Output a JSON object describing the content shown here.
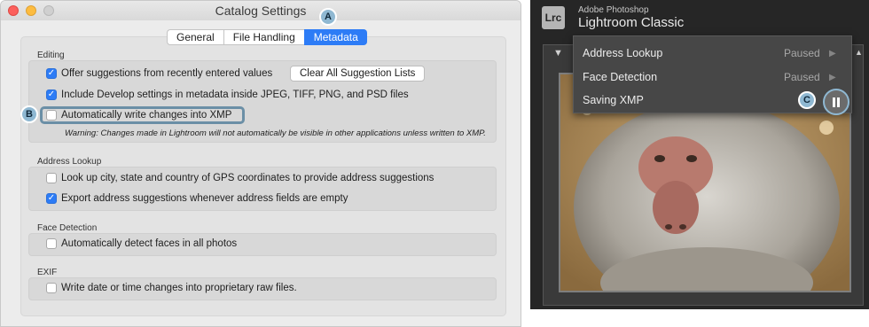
{
  "dialog": {
    "title": "Catalog Settings",
    "tabs": [
      {
        "label": "General",
        "active": false
      },
      {
        "label": "File Handling",
        "active": false
      },
      {
        "label": "Metadata",
        "active": true
      }
    ],
    "sections": {
      "editing": {
        "label": "Editing",
        "offer_suggestions": {
          "label": "Offer suggestions from recently entered values",
          "checked": true
        },
        "clear_button": "Clear All Suggestion Lists",
        "include_develop": {
          "label": "Include Develop settings in metadata inside JPEG, TIFF, PNG, and PSD files",
          "checked": true
        },
        "auto_write_xmp": {
          "label": "Automatically write changes into XMP",
          "checked": false
        },
        "warning": "Warning: Changes made in Lightroom will not automatically be visible in other applications unless written to XMP."
      },
      "address_lookup": {
        "label": "Address Lookup",
        "lookup_gps": {
          "label": "Look up city, state and country of GPS coordinates to provide address suggestions",
          "checked": false
        },
        "export_suggestions": {
          "label": "Export address suggestions whenever address fields are empty",
          "checked": true
        }
      },
      "face_detection": {
        "label": "Face Detection",
        "auto_detect": {
          "label": "Automatically detect faces in all photos",
          "checked": false
        }
      },
      "exif": {
        "label": "EXIF",
        "write_date": {
          "label": "Write date or time changes into proprietary raw files.",
          "checked": false
        }
      }
    }
  },
  "callouts": {
    "a": "A",
    "b": "B",
    "c": "C"
  },
  "lightroom": {
    "logo": "Lrc",
    "brand": "Adobe Photoshop",
    "product": "Lightroom Classic",
    "menu": [
      {
        "label": "Address Lookup",
        "status": "Paused"
      },
      {
        "label": "Face Detection",
        "status": "Paused"
      },
      {
        "label": "Saving XMP",
        "status": ""
      }
    ]
  },
  "colors": {
    "accent": "#2d7cf6",
    "callout": "#8fb8d2",
    "lr_bg": "#262626"
  }
}
